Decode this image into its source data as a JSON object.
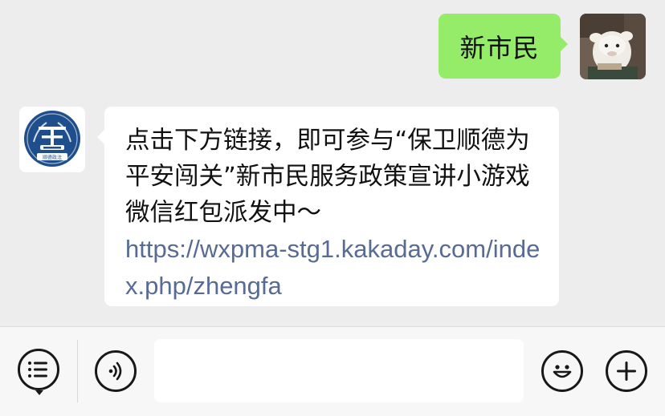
{
  "messages": {
    "outgoing": {
      "text": "新市民",
      "bubble_color": "#95ec69"
    },
    "incoming": {
      "text": "点击下方链接，即可参与“保卫顺德为平安闯关”新市民服务政策宣讲小游戏微信红包派发中～",
      "link": "https://wxpma-stg1.kakaday.com/index.php/zhengfa",
      "link_color": "#576b95",
      "avatar_logo_text": "顺德政法",
      "avatar_logo_color": "#1f4e8c"
    }
  },
  "input_bar": {
    "left_icons": [
      "menu-list-icon",
      "voice-icon"
    ],
    "right_icons": [
      "emoji-icon",
      "plus-icon"
    ],
    "input_value": ""
  }
}
